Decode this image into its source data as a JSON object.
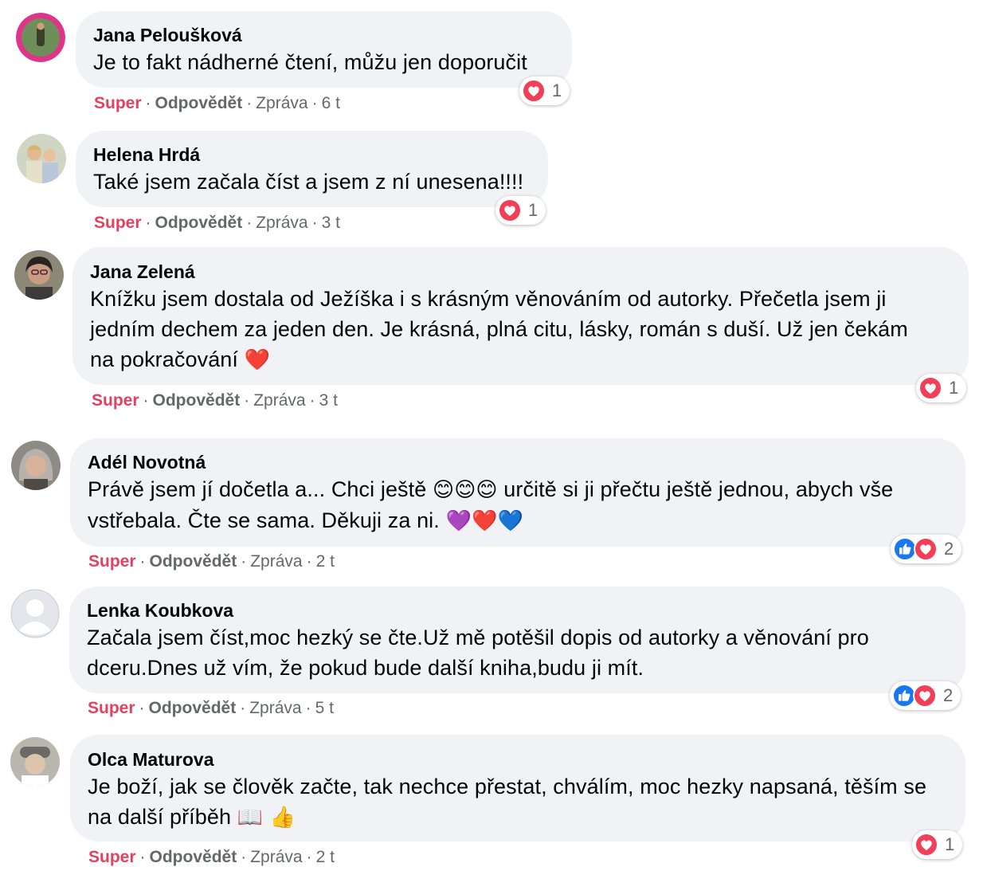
{
  "reactions": {
    "love_color": "#f33e58",
    "like_color": "#1877f2"
  },
  "comments": [
    {
      "author": "Jana Peloušková",
      "text": "Je to fakt nádherné čtení, můžu jen doporučit",
      "reaction_count": "1",
      "reaction_icons": [
        "heart-icon"
      ],
      "actions": {
        "like": "Super",
        "reply": "Odpovědět",
        "message": "Zpráva",
        "time": "6 t"
      }
    },
    {
      "author": "Helena Hrdá",
      "text": "Také jsem začala číst a jsem z ní unesena!!!!",
      "reaction_count": "1",
      "reaction_icons": [
        "heart-icon"
      ],
      "actions": {
        "like": "Super",
        "reply": "Odpovědět",
        "message": "Zpráva",
        "time": "3 t"
      }
    },
    {
      "author": "Jana Zelená",
      "text_line1": "Knížku jsem dostala od Ježíška i s krásným věnováním od autorky. Přečetla jsem ji",
      "text_line2": "jedním dechem za jeden den. Je krásná, plná citu, lásky, román s duší. Už jen čekám",
      "text_line3": "na pokračování",
      "emoji": "❤️",
      "reaction_count": "1",
      "reaction_icons": [
        "heart-icon"
      ],
      "actions": {
        "like": "Super",
        "reply": "Odpovědět",
        "message": "Zpráva",
        "time": "3 t"
      }
    },
    {
      "author": "Adél Novotná",
      "text_line1a": "Právě jsem jí dočetla a... Chci ještě",
      "emoji1": "😊😊😊",
      "text_line1b": "určitě si ji přečtu ještě jednou, abych vše",
      "text_line2": "vstřebala. Čte se sama. Děkuji za ni.",
      "emoji2": "💜❤️💙",
      "reaction_count": "2",
      "reaction_icons": [
        "like-icon",
        "heart-icon"
      ],
      "actions": {
        "like": "Super",
        "reply": "Odpovědět",
        "message": "Zpráva",
        "time": "2 t"
      }
    },
    {
      "author": "Lenka Koubkova",
      "text_line1": "Začala jsem číst,moc hezký se čte.Už mě potěšil dopis od autorky a věnování pro",
      "text_line2": "dceru.Dnes už vím, že pokud bude další kniha,budu ji mít.",
      "reaction_count": "2",
      "reaction_icons": [
        "like-icon",
        "heart-icon"
      ],
      "actions": {
        "like": "Super",
        "reply": "Odpovědět",
        "message": "Zpráva",
        "time": "5 t"
      }
    },
    {
      "author": "Olca Maturova",
      "text_line1": "Je boží, jak se člověk začte, tak nechce přestat, chválím, moc hezky napsaná, těším se",
      "text_line2": "na další příběh",
      "emoji": "📖 👍",
      "reaction_count": "1",
      "reaction_icons": [
        "heart-icon"
      ],
      "actions": {
        "like": "Super",
        "reply": "Odpovědět",
        "message": "Zpráva",
        "time": "2 t"
      }
    }
  ]
}
